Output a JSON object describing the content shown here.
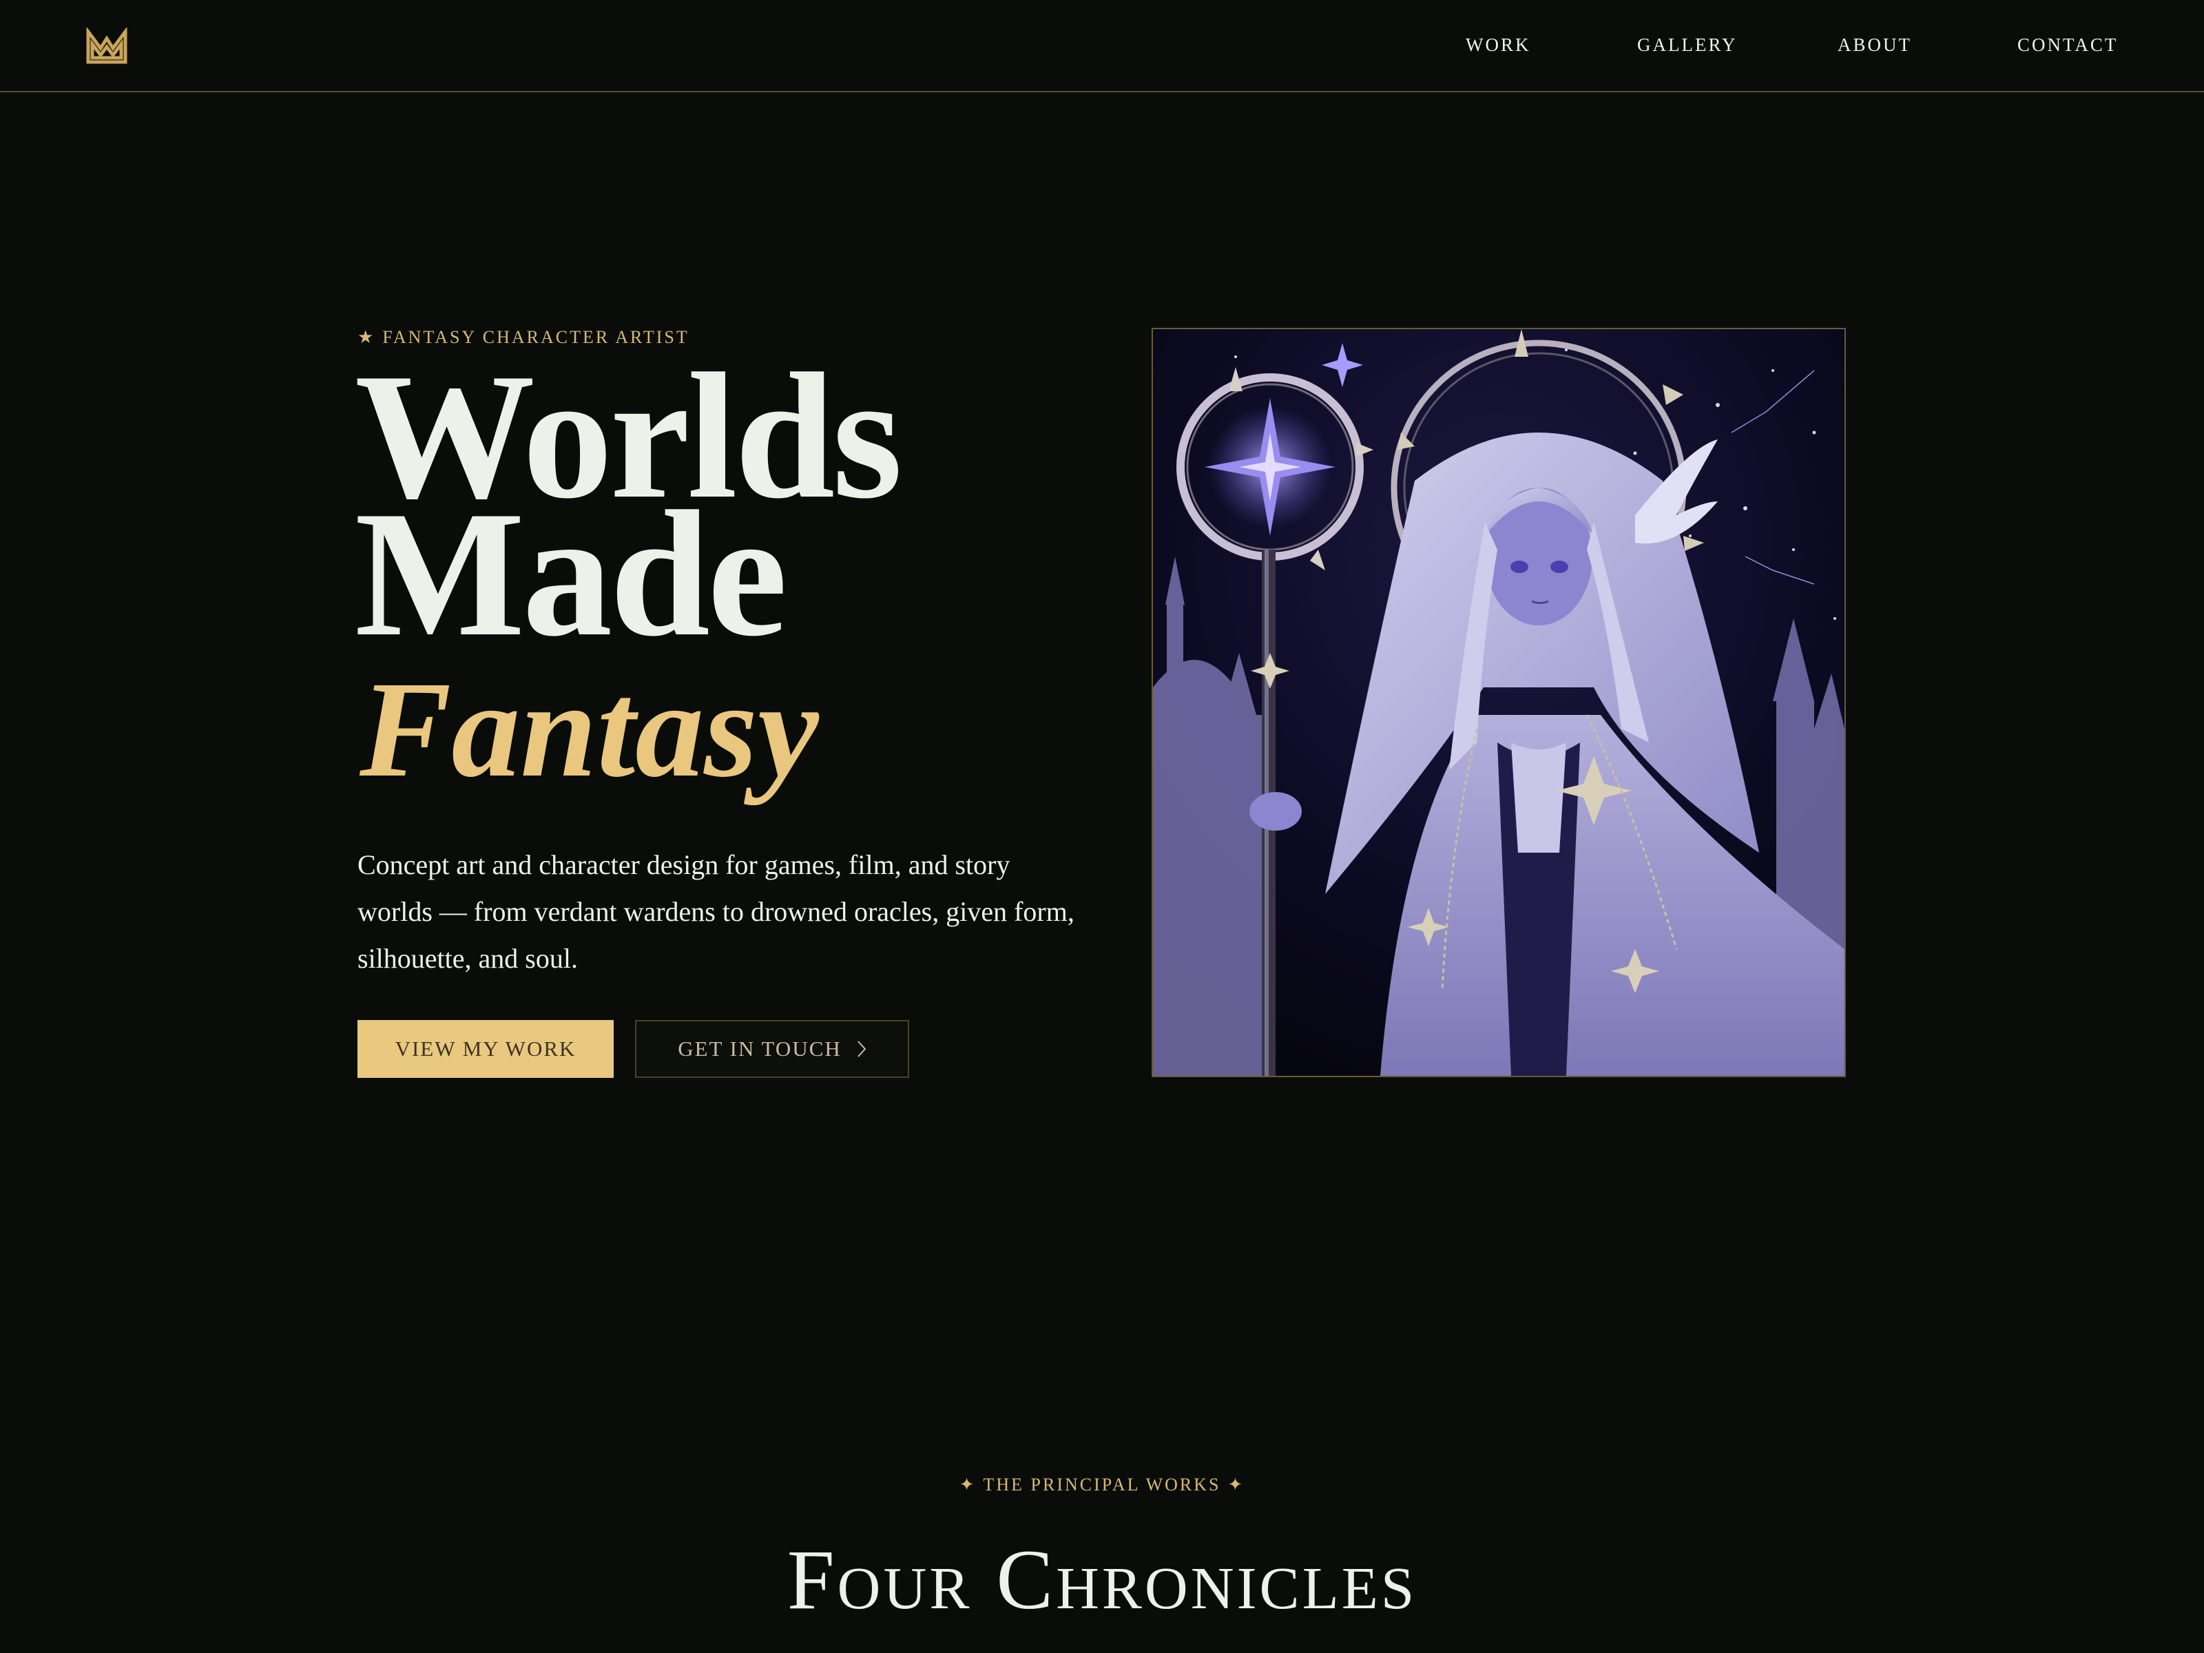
{
  "nav": {
    "logo_icon": "crown-icon",
    "links": [
      "WORK",
      "GALLERY",
      "ABOUT",
      "CONTACT"
    ]
  },
  "hero": {
    "eyebrow_star": "★",
    "eyebrow": "FANTASY CHARACTER ARTIST",
    "headline_line1": "Worlds",
    "headline_line2": "Made",
    "headline_accent": "Fantasy",
    "description": "Concept art and character design for games, film, and story worlds — from verdant wardens to drowned oracles, given form, silhouette, and soul.",
    "primary_button": "VIEW MY WORK",
    "secondary_button": "GET IN TOUCH",
    "secondary_button_icon": "chevron-right-icon",
    "artwork_subject": "celestial-sorceress-artwork"
  },
  "section": {
    "eyebrow_spark_left": "✦",
    "eyebrow": "THE PRINCIPAL WORKS",
    "eyebrow_spark_right": "✦",
    "title": "Four Chronicles"
  },
  "colors": {
    "background": "#090c09",
    "accent_gold": "#e8c97f",
    "text": "#ecf1ea",
    "border": "#5b4c2b"
  }
}
